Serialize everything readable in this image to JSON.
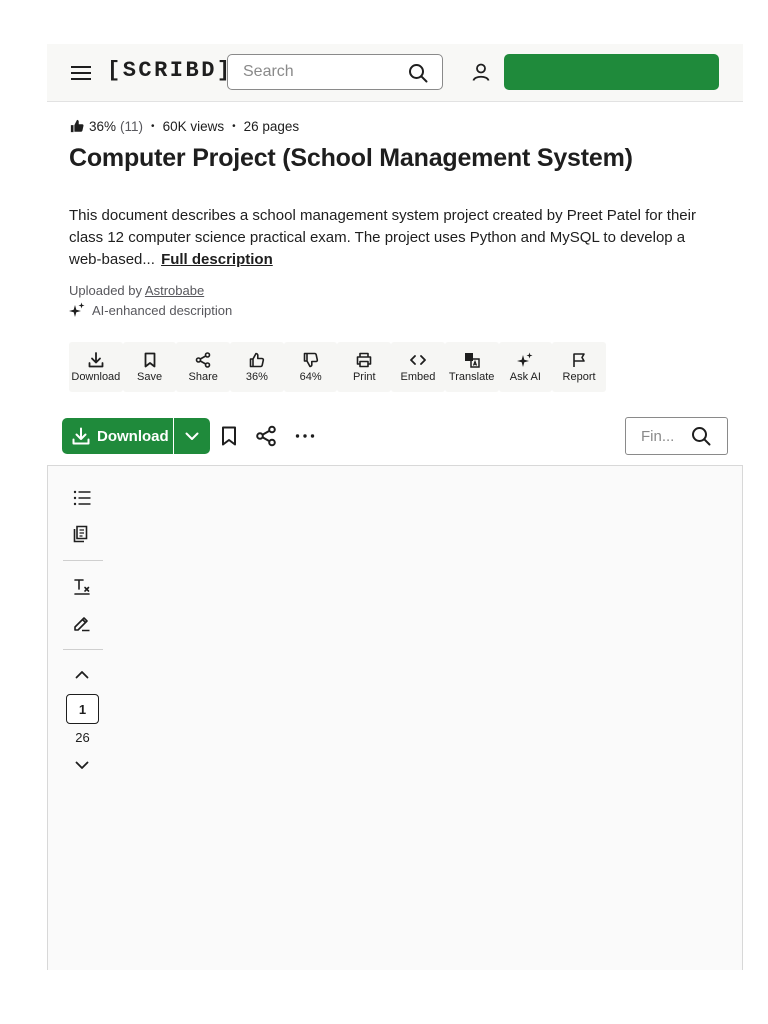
{
  "header": {
    "logo": "[SCRIBD]",
    "search_placeholder": "Search",
    "cta_label": ""
  },
  "meta": {
    "rating": "36%",
    "rating_count": "(11)",
    "views": "60K views",
    "pages": "26 pages"
  },
  "document": {
    "title": "Computer Project (School Management System)",
    "description": "This document describes a school management system project created by Preet Patel for their class 12 computer science practical exam. The project uses Python and MySQL to develop a web-based...",
    "full_description_link": "Full description",
    "uploaded_by_prefix": "Uploaded by",
    "uploader": "Astrobabe",
    "ai_note": "AI-enhanced description"
  },
  "actions": [
    {
      "label": "Download",
      "icon": "download-icon"
    },
    {
      "label": "Save",
      "icon": "bookmark-icon"
    },
    {
      "label": "Share",
      "icon": "share-icon"
    },
    {
      "label": "36%",
      "icon": "thumbs-up-icon"
    },
    {
      "label": "64%",
      "icon": "thumbs-down-icon"
    },
    {
      "label": "Print",
      "icon": "print-icon"
    },
    {
      "label": "Embed",
      "icon": "embed-icon"
    },
    {
      "label": "Translate",
      "icon": "translate-icon"
    },
    {
      "label": "Ask AI",
      "icon": "sparkle-icon"
    },
    {
      "label": "Report",
      "icon": "flag-icon"
    }
  ],
  "toolbar": {
    "download_label": "Download",
    "find_placeholder": "Fin..."
  },
  "viewer": {
    "current_page": "1",
    "total_pages": "26"
  },
  "colors": {
    "accent": "#1f8a3b",
    "header_bg": "#f8f8f6",
    "text": "#1e1e1e",
    "muted": "#57575c"
  }
}
